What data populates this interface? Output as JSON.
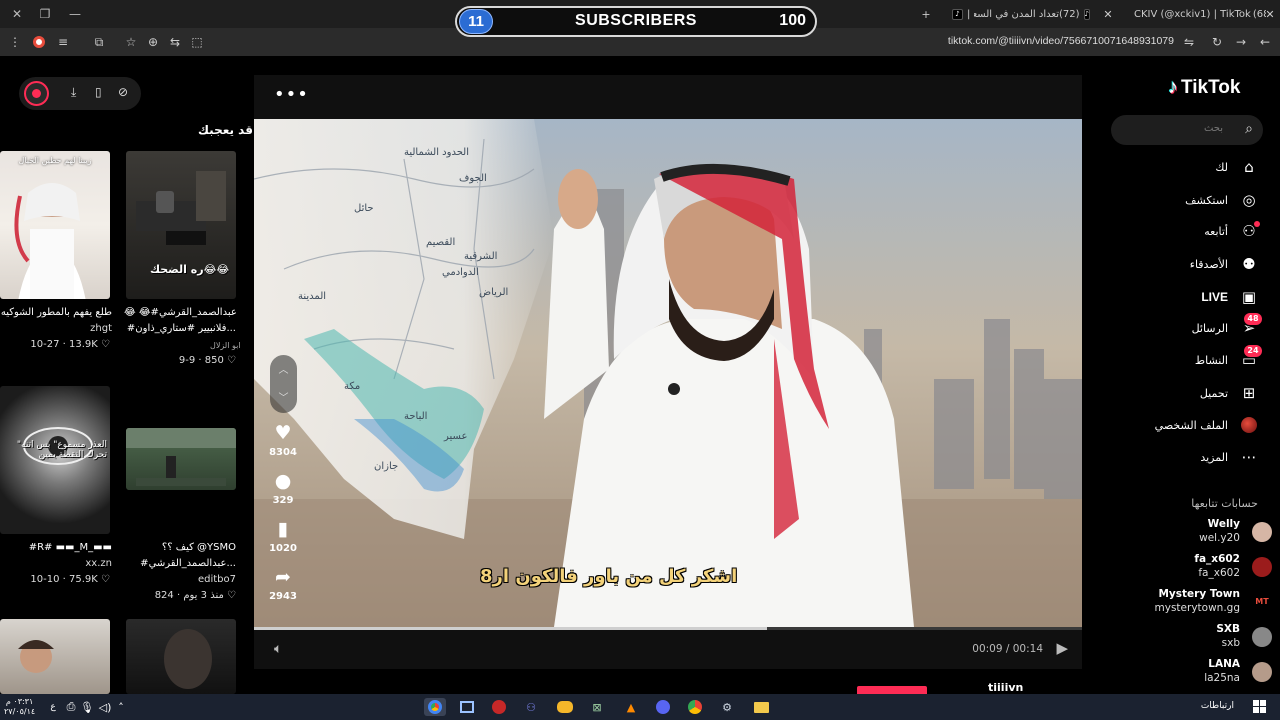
{
  "browser": {
    "tabs": [
      {
        "label": "CKIV (@xckiv1) | TikTok"
      },
      {
        "label": "(68) | TikTok"
      },
      {
        "label": "(72)تعداد المدن في السعودية |"
      },
      {
        "label": "|"
      }
    ],
    "url": "tiktok.com/@tiiiivn/video/7566710071648931079",
    "new_tab_icon": "plus-icon"
  },
  "overlay": {
    "current": "11",
    "label": "SUBSCRIBERS",
    "goal": "100"
  },
  "sidebar": {
    "logo_text": "TikTok",
    "search_placeholder": "بحث",
    "items": [
      {
        "label": "لك",
        "icon": "home-icon"
      },
      {
        "label": "استكشف",
        "icon": "compass-icon"
      },
      {
        "label": "أتابعه",
        "icon": "user-plus-icon"
      },
      {
        "label": "الأصدقاء",
        "icon": "friends-icon"
      },
      {
        "label": "LIVE",
        "icon": "live-tv-icon"
      },
      {
        "label": "الرسائل",
        "icon": "send-icon",
        "badge": "48"
      },
      {
        "label": "النشاط",
        "icon": "inbox-icon",
        "badge": "24"
      },
      {
        "label": "تحميل",
        "icon": "upload-icon"
      },
      {
        "label": "الملف الشخصي",
        "icon": "profile-avatar-icon"
      },
      {
        "label": "المزيد",
        "icon": "more-icon"
      }
    ],
    "following_title": "حسابات تتابعها",
    "accounts": [
      {
        "name": "Welly",
        "handle": "wel.y20",
        "color": "#d6b6a5"
      },
      {
        "name": "fa_x602",
        "handle": "fa_x602",
        "color": "#9b1c1c"
      },
      {
        "name": "Mystery Town",
        "handle": "mysterytown.gg",
        "color": "#c0392b"
      },
      {
        "name": "SXB",
        "handle": "sxb",
        "color": "#888888"
      },
      {
        "name": "LANA",
        "handle": "la25na",
        "color": "#b59b8a"
      }
    ]
  },
  "recommend": {
    "title": "قد يعجبك",
    "cards": [
      {
        "title": "طلع يفهم بالمطور الشوكيه",
        "author": "zhgt",
        "likes": "13.9K",
        "date": "10-27",
        "overlay": "زيبنا لهم حطين الخيال"
      },
      {
        "title": "😂 😂#عبدالصمد_القرشي",
        "title2": "#فلانبيير #ستاري_ذاون...",
        "author": "ابو الزلال",
        "likes": "850",
        "date": "9-9",
        "overlay": "ره الضحك😂😂"
      },
      {
        "title": "#R# ▬▬_M_▬▬",
        "author": "xx.zn",
        "likes": "75.9K",
        "date": "10-10",
        "overlay": "\"العذر مسموع\" بس اتنه تحرك النقطة يمين"
      },
      {
        "title": "كيف ؟؟ @YSMO",
        "title2": "#عبدالصمد_القرشي...",
        "author": "editbo7",
        "likes": "824",
        "date": "منذ 3 يوم"
      }
    ]
  },
  "video": {
    "subtitle": "اشكر كل من باور فالكون ار8",
    "progress": 0.62,
    "time": "00:09 / 00:14",
    "likes": "8304",
    "comments": "329",
    "saves": "1020",
    "shares": "2943",
    "author": "tiiiivn",
    "map_labels": [
      "الجوف",
      "حائل",
      "القصيم",
      "الرياض",
      "المدينة",
      "مكة",
      "الباحة",
      "عسير",
      "جازان",
      "الشرقية",
      "الدوادمي",
      "الحدود الشمالية"
    ]
  },
  "taskbar": {
    "time": "٠٣:٣١ م",
    "date": "٢٧/٠٥/١٤",
    "links_label": "ارتباطات",
    "apps": [
      "chrome-icon",
      "tasks-icon",
      "game-icon",
      "people-icon",
      "discord-icon",
      "excel-icon",
      "vlc-icon",
      "obs-icon",
      "browser-icon",
      "steam-icon",
      "folder-icon"
    ]
  },
  "colors": {
    "accent": "#fe2c55",
    "cyan": "#25f4ee"
  }
}
